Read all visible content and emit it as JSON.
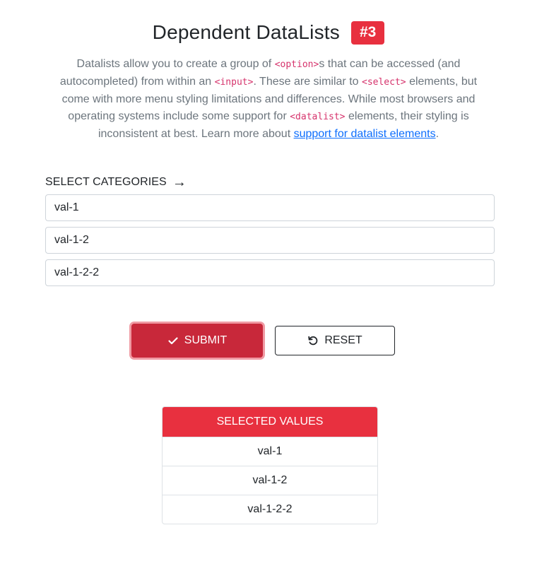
{
  "header": {
    "title": "Dependent DataLists",
    "badge": "#3"
  },
  "intro": {
    "t1": "Datalists allow you to create a group of ",
    "c1": "<option>",
    "t2": "s that can be accessed (and autocompleted) from within an ",
    "c2": "<input>",
    "t3": ". These are similar to ",
    "c3": "<select>",
    "t4": " elements, but come with more menu styling limitations and differences. While most browsers and operating systems include some support for ",
    "c4": "<datalist>",
    "t5": " elements, their styling is inconsistent at best. Learn more about ",
    "link": "support for datalist elements",
    "t6": "."
  },
  "select": {
    "label": "SELECT CATEGORIES",
    "arrow": "→"
  },
  "fields": [
    "val-1",
    "val-1-2",
    "val-1-2-2"
  ],
  "buttons": {
    "submit": "SUBMIT",
    "reset": "RESET"
  },
  "results": {
    "header": "SELECTED VALUES",
    "rows": [
      "val-1",
      "val-1-2",
      "val-1-2-2"
    ]
  },
  "colors": {
    "accent": "#e8303f",
    "submit": "#c8283a",
    "code": "#d6336c",
    "link": "#0d6efd"
  },
  "icons": {
    "submit": "check-icon",
    "reset": "rotate-ccw-icon",
    "label": "arrow-right-icon"
  }
}
